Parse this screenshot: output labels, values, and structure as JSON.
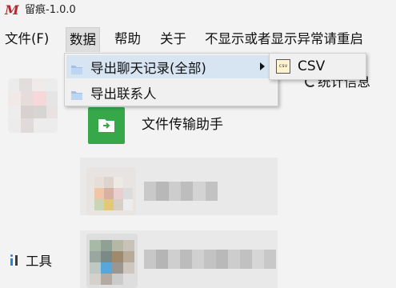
{
  "window": {
    "logo_text": "M",
    "title": "留痕-1.0.0"
  },
  "menu": {
    "items": [
      {
        "label": "文件(F)"
      },
      {
        "label": "数据"
      },
      {
        "label": "帮助"
      },
      {
        "label": "关于"
      },
      {
        "label": "不显示或者显示异常请重启"
      }
    ]
  },
  "data_menu": {
    "items": [
      {
        "label": "导出聊天记录(全部)",
        "icon": "folder-icon",
        "has_submenu": true
      },
      {
        "label": "导出联系人",
        "icon": "folder-icon",
        "has_submenu": false
      }
    ],
    "submenu": {
      "items": [
        {
          "label": "CSV",
          "icon": "csv-file-icon",
          "icon_text": "csv"
        }
      ]
    }
  },
  "main": {
    "stats_label": "统计信息",
    "file_helper": {
      "label": "文件传输助手"
    }
  },
  "sidebar": {
    "tools_label": "工具"
  },
  "colors": {
    "accent_green": "#36a84a",
    "logo_red": "#b8262b",
    "menu_hover": "#d7e4f2"
  }
}
